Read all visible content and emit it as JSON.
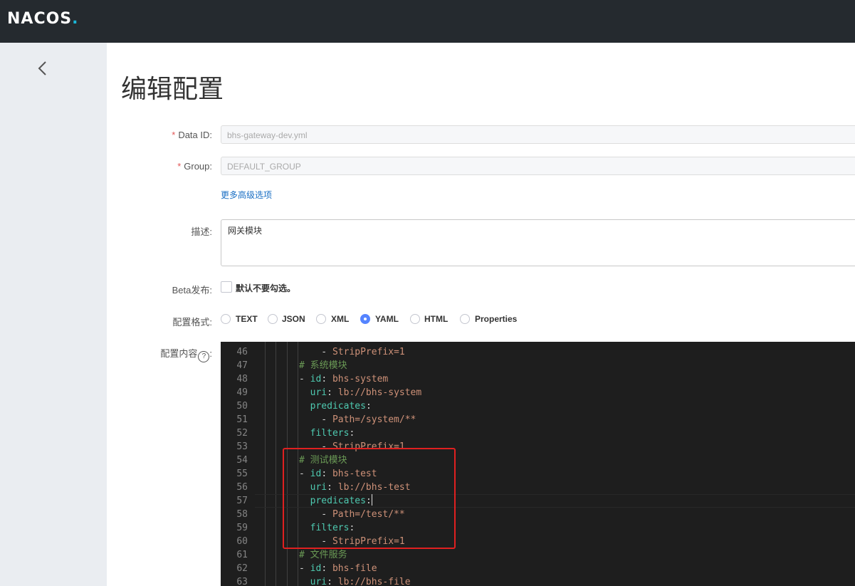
{
  "app": {
    "logo": "NACOS",
    "logo_dot": "."
  },
  "page": {
    "title": "编辑配置"
  },
  "form": {
    "data_id": {
      "label": "Data ID:",
      "required": "*",
      "value": "bhs-gateway-dev.yml"
    },
    "group": {
      "label": "Group:",
      "required": "*",
      "value": "DEFAULT_GROUP"
    },
    "advanced_link": "更多高级选项",
    "description": {
      "label": "描述:",
      "value": "网关模块"
    },
    "beta": {
      "label": "Beta发布:",
      "checkbox_text": "默认不要勾选。",
      "checked": false
    },
    "format": {
      "label": "配置格式:",
      "options": [
        "TEXT",
        "JSON",
        "XML",
        "YAML",
        "HTML",
        "Properties"
      ],
      "selected": "YAML"
    },
    "content": {
      "label": "配置内容",
      "help_icon": "?"
    }
  },
  "editor": {
    "lines": [
      {
        "n": "46",
        "segs": [
          [
            "d",
            "    - "
          ],
          [
            "v",
            "StripPrefix=1"
          ]
        ]
      },
      {
        "n": "47",
        "segs": [
          [
            "c",
            "# 系统模块"
          ]
        ]
      },
      {
        "n": "48",
        "segs": [
          [
            "d",
            "- "
          ],
          [
            "k",
            "id"
          ],
          [
            "d",
            ": "
          ],
          [
            "v",
            "bhs-system"
          ]
        ]
      },
      {
        "n": "49",
        "segs": [
          [
            "d",
            "  "
          ],
          [
            "k",
            "uri"
          ],
          [
            "d",
            ": "
          ],
          [
            "v",
            "lb://bhs-system"
          ]
        ]
      },
      {
        "n": "50",
        "segs": [
          [
            "d",
            "  "
          ],
          [
            "k",
            "predicates"
          ],
          [
            "d",
            ":"
          ]
        ]
      },
      {
        "n": "51",
        "segs": [
          [
            "d",
            "    - "
          ],
          [
            "v",
            "Path=/system/**"
          ]
        ]
      },
      {
        "n": "52",
        "segs": [
          [
            "d",
            "  "
          ],
          [
            "k",
            "filters"
          ],
          [
            "d",
            ":"
          ]
        ]
      },
      {
        "n": "53",
        "segs": [
          [
            "d",
            "    - "
          ],
          [
            "v",
            "StripPrefix=1"
          ]
        ]
      },
      {
        "n": "54",
        "segs": [
          [
            "c",
            "# 测试模块"
          ]
        ]
      },
      {
        "n": "55",
        "segs": [
          [
            "d",
            "- "
          ],
          [
            "k",
            "id"
          ],
          [
            "d",
            ": "
          ],
          [
            "v",
            "bhs-test"
          ]
        ]
      },
      {
        "n": "56",
        "segs": [
          [
            "d",
            "  "
          ],
          [
            "k",
            "uri"
          ],
          [
            "d",
            ": "
          ],
          [
            "v",
            "lb://bhs-test"
          ]
        ]
      },
      {
        "n": "57",
        "segs": [
          [
            "d",
            "  "
          ],
          [
            "k",
            "predicates"
          ],
          [
            "d",
            ":"
          ]
        ],
        "cursor": true
      },
      {
        "n": "58",
        "segs": [
          [
            "d",
            "    - "
          ],
          [
            "v",
            "Path=/test/**"
          ]
        ]
      },
      {
        "n": "59",
        "segs": [
          [
            "d",
            "  "
          ],
          [
            "k",
            "filters"
          ],
          [
            "d",
            ":"
          ]
        ]
      },
      {
        "n": "60",
        "segs": [
          [
            "d",
            "    - "
          ],
          [
            "v",
            "StripPrefix=1"
          ]
        ]
      },
      {
        "n": "61",
        "segs": [
          [
            "c",
            "# 文件服务"
          ]
        ]
      },
      {
        "n": "62",
        "segs": [
          [
            "d",
            "- "
          ],
          [
            "k",
            "id"
          ],
          [
            "d",
            ": "
          ],
          [
            "v",
            "bhs-file"
          ]
        ]
      },
      {
        "n": "63",
        "segs": [
          [
            "d",
            "  "
          ],
          [
            "k",
            "uri"
          ],
          [
            "d",
            ": "
          ],
          [
            "v",
            "lb://bhs-file"
          ]
        ]
      }
    ]
  },
  "colors": {
    "topbar": "#252a2f",
    "sidebar": "#eaedf1",
    "accent": "#5584ff",
    "link": "#1a6fc4",
    "annotation_box": "#e02020"
  }
}
